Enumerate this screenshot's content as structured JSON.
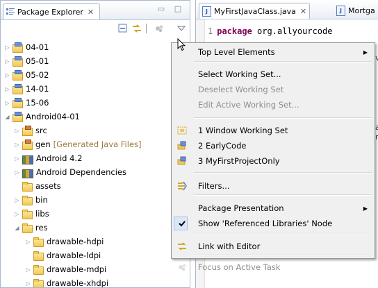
{
  "explorer": {
    "tab_title": "Package Explorer",
    "tab_close": "✕",
    "minimize_glyph": "▭",
    "maximize_glyph": "□",
    "tree": [
      {
        "label": "04-01",
        "decor": "",
        "icon": "project-icon",
        "expanded": false
      },
      {
        "label": "05-01",
        "decor": "",
        "icon": "project-icon",
        "expanded": false
      },
      {
        "label": "05-02",
        "decor": "",
        "icon": "project-icon",
        "expanded": false
      },
      {
        "label": "14-01",
        "decor": "",
        "icon": "project-icon",
        "expanded": false
      },
      {
        "label": "15-06",
        "decor": "",
        "icon": "project-icon",
        "expanded": false
      },
      {
        "label": "Android04-01",
        "decor": "",
        "icon": "project-icon",
        "expanded": true
      },
      {
        "label": "src",
        "decor": "",
        "icon": "source-folder-icon",
        "expanded": false
      },
      {
        "label": "gen",
        "decor": "[Generated Java Files]",
        "icon": "source-folder-icon",
        "expanded": false
      },
      {
        "label": "Android 4.2",
        "decor": "",
        "icon": "library-icon",
        "expanded": false
      },
      {
        "label": "Android Dependencies",
        "decor": "",
        "icon": "library-icon",
        "expanded": false
      },
      {
        "label": "assets",
        "decor": "",
        "icon": "folder-icon",
        "expanded": null
      },
      {
        "label": "bin",
        "decor": "",
        "icon": "folder-icon",
        "expanded": false
      },
      {
        "label": "libs",
        "decor": "",
        "icon": "folder-icon",
        "expanded": false
      },
      {
        "label": "res",
        "decor": "",
        "icon": "folder-icon",
        "expanded": true
      },
      {
        "label": "drawable-hdpi",
        "decor": "",
        "icon": "folder-icon",
        "expanded": false
      },
      {
        "label": "drawable-ldpi",
        "decor": "",
        "icon": "folder-icon",
        "expanded": null
      },
      {
        "label": "drawable-mdpi",
        "decor": "",
        "icon": "folder-icon",
        "expanded": false
      },
      {
        "label": "drawable-xhdpi",
        "decor": "",
        "icon": "folder-icon",
        "expanded": false
      }
    ]
  },
  "editor": {
    "tabs": [
      {
        "label": "MyFirstJavaClass.java",
        "close": "✕",
        "active": true
      },
      {
        "label": "Mortga",
        "close": "",
        "active": false
      }
    ],
    "line_number": "1",
    "keyword": "package",
    "code_text": "org.allyourcode",
    "fragments": [
      "v",
      "a",
      "n"
    ]
  },
  "menu": {
    "items": [
      {
        "type": "item",
        "label": "Top Level Elements",
        "icon": "",
        "submenu": true,
        "disabled": false
      },
      {
        "type": "separator"
      },
      {
        "type": "item",
        "label": "Select Working Set...",
        "icon": "",
        "submenu": false,
        "disabled": false
      },
      {
        "type": "item",
        "label": "Deselect Working Set",
        "icon": "",
        "submenu": false,
        "disabled": true
      },
      {
        "type": "item",
        "label": "Edit Active Working Set...",
        "icon": "",
        "submenu": false,
        "disabled": true
      },
      {
        "type": "separator"
      },
      {
        "type": "item",
        "label": "1 Window Working Set",
        "icon": "window-working-set-icon",
        "submenu": false,
        "disabled": false
      },
      {
        "type": "item",
        "label": "2 EarlyCode",
        "icon": "working-set-icon",
        "submenu": false,
        "disabled": false
      },
      {
        "type": "item",
        "label": "3 MyFirstProjectOnly",
        "icon": "working-set-icon",
        "submenu": false,
        "disabled": false
      },
      {
        "type": "separator"
      },
      {
        "type": "item",
        "label": "Filters...",
        "icon": "filter-icon",
        "submenu": false,
        "disabled": false
      },
      {
        "type": "separator"
      },
      {
        "type": "item",
        "label": "Package Presentation",
        "icon": "",
        "submenu": true,
        "disabled": false
      },
      {
        "type": "item",
        "label": "Show 'Referenced Libraries' Node",
        "icon": "check-icon",
        "submenu": false,
        "disabled": false,
        "checked": true
      },
      {
        "type": "separator"
      },
      {
        "type": "item",
        "label": "Link with Editor",
        "icon": "link-editor-icon",
        "submenu": false,
        "disabled": false
      },
      {
        "type": "separator"
      },
      {
        "type": "item",
        "label": "Focus on Active Task",
        "icon": "focus-task-icon",
        "submenu": false,
        "disabled": true
      }
    ]
  },
  "colors": {
    "accent": "#3f66b0",
    "keyword": "#7f0055",
    "decoration": "#9a7b3e",
    "menu_bg": "#f0f0f0"
  }
}
